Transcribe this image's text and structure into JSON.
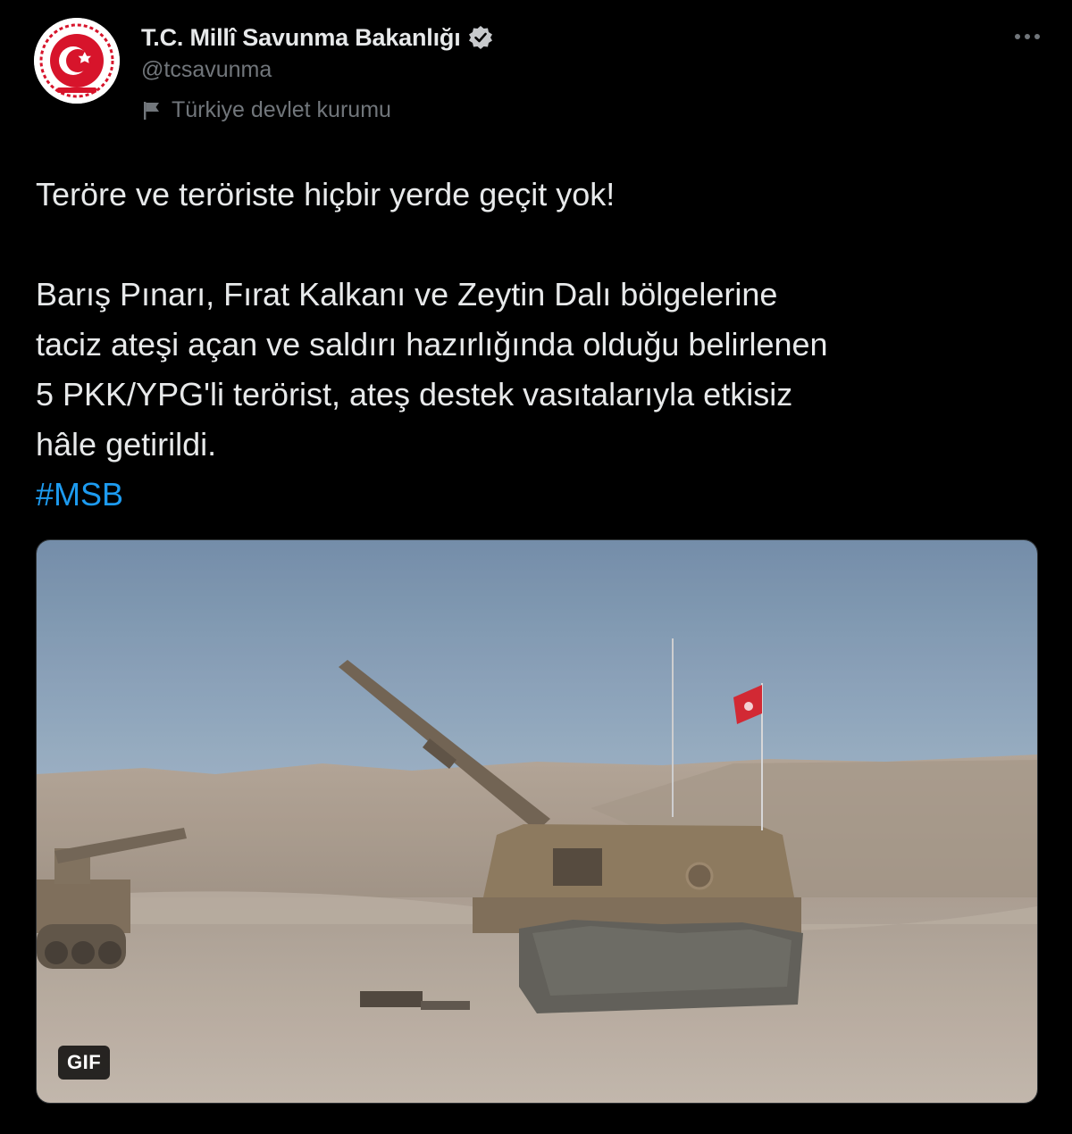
{
  "author": {
    "display_name": "T.C. Millî Savunma Bakanlığı",
    "handle": "@tcsavunma",
    "label": "Türkiye devlet kurumu",
    "verified": true,
    "avatar_icon": "ministry-emblem-icon"
  },
  "tweet": {
    "line1": "Teröre ve teröriste hiçbir yerde geçit yok!",
    "body_line1": "Barış Pınarı, Fırat Kalkanı ve Zeytin Dalı bölgelerine",
    "body_line2": "taciz ateşi açan ve saldırı hazırlığında olduğu belirlenen",
    "body_line3": "5 PKK/YPG'li terörist, ateş destek vasıtalarıyla etkisiz",
    "body_line4": "hâle getirildi.",
    "hashtag": "#MSB"
  },
  "media": {
    "badge": "GIF",
    "description_icon": "artillery-scene-image"
  },
  "colors": {
    "background": "#000000",
    "text": "#e7e9ea",
    "secondary": "#71767b",
    "link": "#1d9bf0",
    "emblem_red": "#d7142b"
  },
  "icons": {
    "more": "more-icon",
    "verified": "verified-badge-icon",
    "label": "flag-icon"
  }
}
